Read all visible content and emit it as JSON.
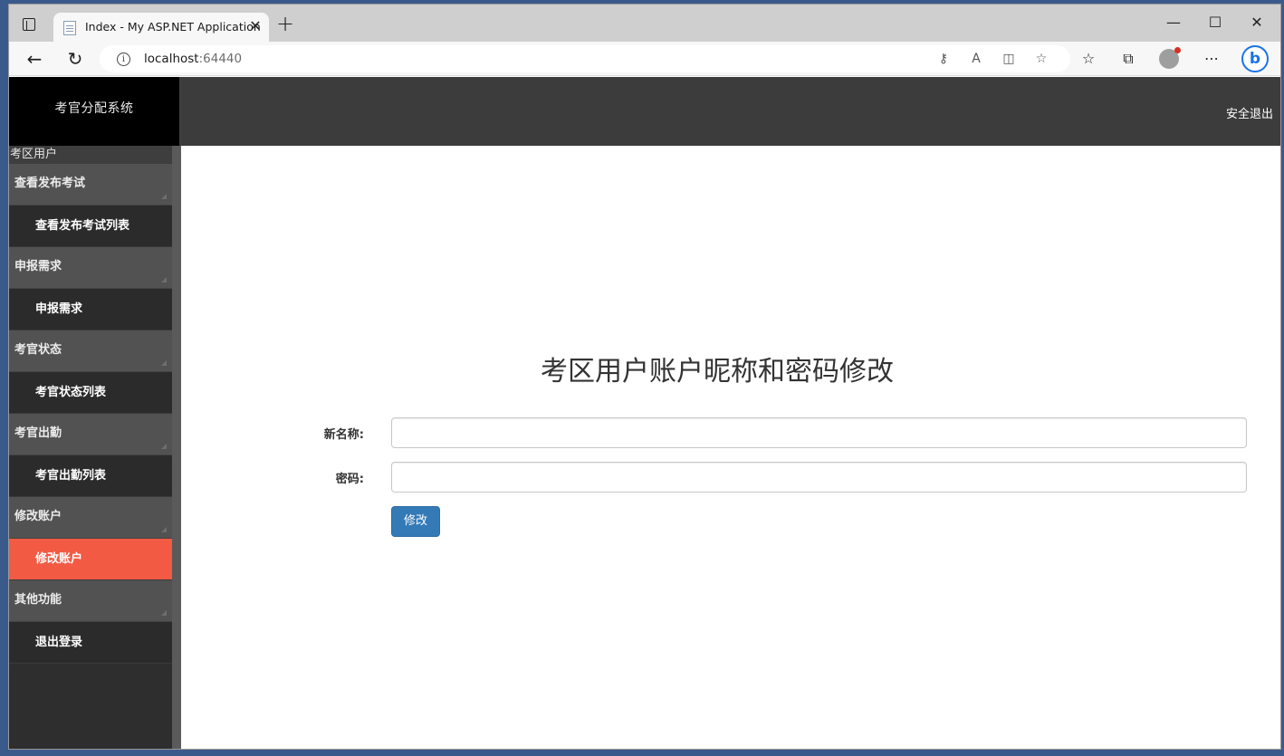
{
  "browser": {
    "tab_title": "Index - My ASP.NET Application",
    "url_host": "localhost",
    "url_port": ":64440",
    "window_controls": {
      "minimize": "—",
      "maximize": "☐",
      "close": "✕"
    }
  },
  "app": {
    "brand": "考官分配系统",
    "logout_link": "安全退出",
    "user_role": "考区用户"
  },
  "sidebar": {
    "groups": [
      {
        "label": "查看发布考试",
        "items": [
          "查看发布考试列表"
        ]
      },
      {
        "label": "申报需求",
        "items": [
          "申报需求"
        ]
      },
      {
        "label": "考官状态",
        "items": [
          "考官状态列表"
        ]
      },
      {
        "label": "考官出勤",
        "items": [
          "考官出勤列表"
        ]
      },
      {
        "label": "修改账户",
        "items": [
          "修改账户"
        ]
      },
      {
        "label": "其他功能",
        "items": [
          "退出登录"
        ]
      }
    ],
    "active_item": "修改账户",
    "active_color": "#f25a43"
  },
  "form": {
    "title": "考区用户账户昵称和密码修改",
    "name_label": "新名称:",
    "name_value": "",
    "password_label": "密码:",
    "password_value": "",
    "submit_label": "修改",
    "submit_color": "#337ab7"
  },
  "icons": {
    "tab_actions": "tab-actions-icon",
    "favicon": "page-icon",
    "back": "back-arrow-icon",
    "refresh": "refresh-icon",
    "info": "info-icon",
    "key": "key-icon",
    "read_aloud": "read-aloud-icon",
    "split": "split-screen-icon",
    "favorite_add": "add-favorite-icon",
    "favorites": "favorites-icon",
    "collections": "collections-icon",
    "profile": "profile-icon",
    "more": "more-icon",
    "bing": "bing-icon"
  }
}
